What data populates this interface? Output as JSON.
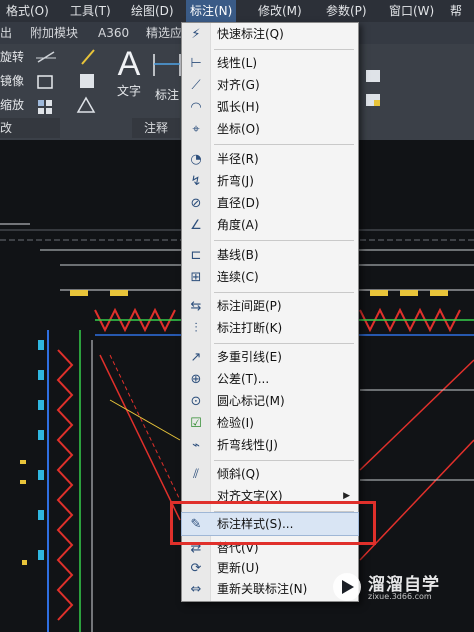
{
  "menubar": {
    "items": [
      "格式(O)",
      "工具(T)",
      "绘图(D)",
      "标注(N)",
      "修改(M)",
      "参数(P)",
      "窗口(W)",
      "帮助"
    ]
  },
  "ribbon": {
    "tabs": [
      "出",
      "附加模块",
      "A360",
      "精选应"
    ],
    "left_tools": [
      "旋转",
      "镜像",
      "缩放"
    ],
    "text_tool": "文字",
    "dim_tool": "标注",
    "panels": [
      "改",
      "注释"
    ]
  },
  "dim_menu": {
    "items": [
      {
        "label": "快速标注(Q)",
        "icon": "quick-dim-icon"
      },
      {
        "label": "线性(L)",
        "icon": "linear-icon"
      },
      {
        "label": "对齐(G)",
        "icon": "aligned-icon"
      },
      {
        "label": "弧长(H)",
        "icon": "arc-length-icon"
      },
      {
        "label": "坐标(O)",
        "icon": "ordinate-icon"
      },
      {
        "label": "半径(R)",
        "icon": "radius-icon"
      },
      {
        "label": "折弯(J)",
        "icon": "jogged-icon"
      },
      {
        "label": "直径(D)",
        "icon": "diameter-icon"
      },
      {
        "label": "角度(A)",
        "icon": "angular-icon"
      },
      {
        "label": "基线(B)",
        "icon": "baseline-icon"
      },
      {
        "label": "连续(C)",
        "icon": "continue-icon"
      },
      {
        "label": "标注间距(P)",
        "icon": "dim-space-icon"
      },
      {
        "label": "标注打断(K)",
        "icon": "dim-break-icon"
      },
      {
        "label": "多重引线(E)",
        "icon": "multileader-icon"
      },
      {
        "label": "公差(T)...",
        "icon": "tolerance-icon"
      },
      {
        "label": "圆心标记(M)",
        "icon": "center-mark-icon"
      },
      {
        "label": "检验(I)",
        "icon": "inspect-icon"
      },
      {
        "label": "折弯线性(J)",
        "icon": "jog-line-icon"
      },
      {
        "label": "倾斜(Q)",
        "icon": "oblique-icon"
      },
      {
        "label": "对齐文字(X)",
        "icon": ""
      },
      {
        "label": "标注样式(S)...",
        "icon": "dim-style-icon"
      },
      {
        "label": "替代(V)",
        "icon": "override-icon"
      },
      {
        "label": "更新(U)",
        "icon": "update-icon"
      },
      {
        "label": "重新关联标注(N)",
        "icon": "reassociate-icon"
      }
    ]
  },
  "watermark": {
    "title": "溜溜自学",
    "url": "zixue.3d66.com"
  },
  "colors": {
    "accent_red": "#e0302b",
    "menu_highlight": "#3a5b87"
  }
}
